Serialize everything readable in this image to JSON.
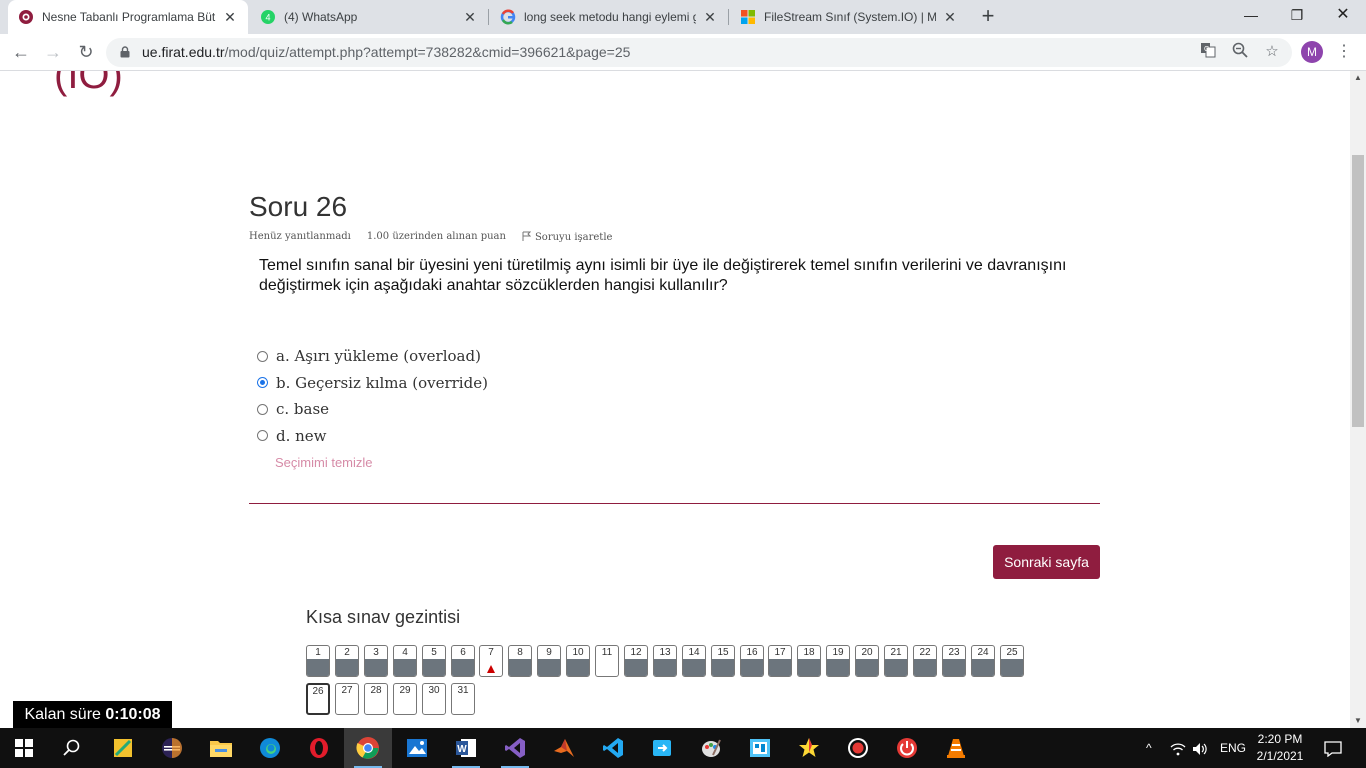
{
  "browser": {
    "tabs": [
      {
        "title": "Nesne Tabanlı Programlama Bütü",
        "active": true,
        "icon": "moodle-icon"
      },
      {
        "title": "(4) WhatsApp",
        "active": false,
        "icon": "whatsapp-icon"
      },
      {
        "title": "long seek metodu hangi eylemi g",
        "active": false,
        "icon": "google-icon"
      },
      {
        "title": "FileStream Sınıf (System.IO) | Mic",
        "active": false,
        "icon": "microsoft-icon"
      }
    ],
    "url_host": "ue.firat.edu.tr",
    "url_path": "/mod/quiz/attempt.php?attempt=738282&cmid=396621&page=25",
    "profile_initial": "M"
  },
  "page": {
    "prev_heading": "(IO)",
    "question": {
      "title": "Soru 26",
      "status": "Henüz yanıtlanmadı",
      "points": "1.00 üzerinden alınan puan",
      "flag_label": "Soruyu işaretle",
      "text": "Temel sınıfın sanal bir üyesini yeni türetilmiş aynı isimli bir üye ile değiştirerek temel sınıfın verilerini ve davranışını değiştirmek için aşağıdaki anahtar sözcüklerden hangisi kullanılır?",
      "answers": [
        {
          "label": "a. Aşırı yükleme (overload)",
          "selected": false
        },
        {
          "label": "b. Geçersiz kılma (override)",
          "selected": true
        },
        {
          "label": "c. base",
          "selected": false
        },
        {
          "label": "d. new",
          "selected": false
        }
      ],
      "clear_choice": "Seçimimi temizle"
    },
    "next_button": "Sonraki sayfa",
    "quiz_nav": {
      "title": "Kısa sınav gezintisi",
      "buttons": [
        {
          "num": "1",
          "state": "answered"
        },
        {
          "num": "2",
          "state": "answered"
        },
        {
          "num": "3",
          "state": "answered"
        },
        {
          "num": "4",
          "state": "answered"
        },
        {
          "num": "5",
          "state": "answered"
        },
        {
          "num": "6",
          "state": "answered"
        },
        {
          "num": "7",
          "state": "flagged"
        },
        {
          "num": "8",
          "state": "answered"
        },
        {
          "num": "9",
          "state": "answered"
        },
        {
          "num": "10",
          "state": "answered"
        },
        {
          "num": "11",
          "state": "notyet"
        },
        {
          "num": "12",
          "state": "answered"
        },
        {
          "num": "13",
          "state": "answered"
        },
        {
          "num": "14",
          "state": "answered"
        },
        {
          "num": "15",
          "state": "answered"
        },
        {
          "num": "16",
          "state": "answered"
        },
        {
          "num": "17",
          "state": "answered"
        },
        {
          "num": "18",
          "state": "answered"
        },
        {
          "num": "19",
          "state": "answered"
        },
        {
          "num": "20",
          "state": "answered"
        },
        {
          "num": "21",
          "state": "answered"
        },
        {
          "num": "22",
          "state": "answered"
        },
        {
          "num": "23",
          "state": "answered"
        },
        {
          "num": "24",
          "state": "answered"
        },
        {
          "num": "25",
          "state": "answered"
        },
        {
          "num": "26",
          "state": "current"
        },
        {
          "num": "27",
          "state": "notyet"
        },
        {
          "num": "28",
          "state": "notyet"
        },
        {
          "num": "29",
          "state": "notyet"
        },
        {
          "num": "30",
          "state": "notyet"
        },
        {
          "num": "31",
          "state": "notyet"
        }
      ]
    },
    "timer": {
      "label": "Kalan süre",
      "value": "0:10:08"
    }
  },
  "taskbar": {
    "apps": [
      "start-icon",
      "search-icon",
      "app-icon-1",
      "eclipse-icon",
      "file-explorer-icon",
      "edge-icon",
      "opera-icon",
      "chrome-icon",
      "photos-icon",
      "word-icon",
      "visual-studio-icon",
      "matlab-icon",
      "vscode-icon",
      "app-icon-2",
      "paint-icon",
      "app-icon-3",
      "star-icon",
      "record-icon",
      "power-icon",
      "vlc-icon"
    ],
    "language": "ENG",
    "time": "2:20 PM",
    "date": "2/1/2021"
  },
  "colors": {
    "accent": "#8f1d3f",
    "clear_link": "#d68ba7",
    "nav_answered": "#6c757d"
  }
}
